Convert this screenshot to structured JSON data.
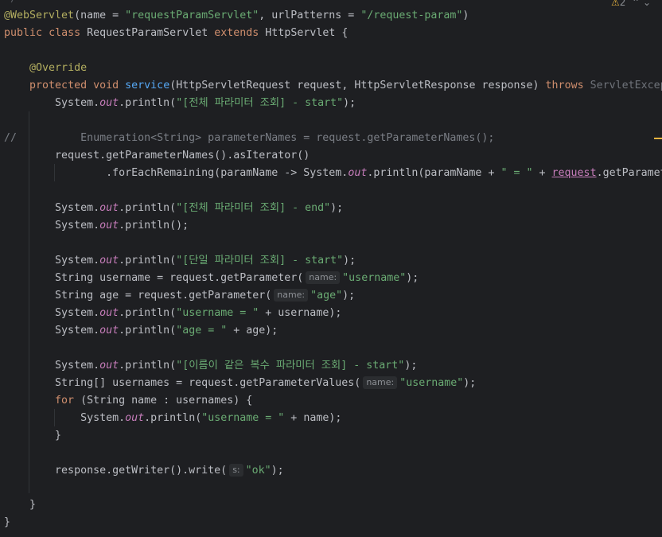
{
  "editor": {
    "inspection": {
      "warning_count": "2"
    },
    "top_fragment": "*/",
    "lines": {
      "l1": {
        "annotation": "@WebServlet",
        "p1": "(name = ",
        "s1": "\"requestParamServlet\"",
        "p2": ", urlPatterns = ",
        "s2": "\"/request-param\"",
        "p3": ")"
      },
      "l2": {
        "k1": "public",
        "k2": "class",
        "name": "RequestParamServlet",
        "k3": "extends",
        "parent": "HttpServlet {"
      },
      "l4": {
        "annotation": "@Override"
      },
      "l5": {
        "k1": "protected",
        "k2": "void",
        "method": "service",
        "params": "(HttpServletRequest request, HttpServletResponse response)",
        "k3": "throws",
        "exc": "ServletException"
      },
      "l6": {
        "a": "System.",
        "f": "out",
        "b": ".println(",
        "s": "\"[전체 파라미터 조회] - start\"",
        "c": ");"
      },
      "l8": {
        "comment": "//",
        "code": "Enumeration<String> parameterNames = request.getParameterNames();"
      },
      "l9": {
        "code": "request.getParameterNames().asIterator()"
      },
      "l10": {
        "a": ".forEachRemaining(paramName -> System.",
        "f": "out",
        "b": ".println(paramName + ",
        "s": "\" = \"",
        "c": " + ",
        "ref": "request",
        "d": ".getParameter(paramName)));"
      },
      "l12": {
        "a": "System.",
        "f": "out",
        "b": ".println(",
        "s": "\"[전체 파라미터 조회] - end\"",
        "c": ");"
      },
      "l13": {
        "a": "System.",
        "f": "out",
        "b": ".println();"
      },
      "l15": {
        "a": "System.",
        "f": "out",
        "b": ".println(",
        "s": "\"[단일 파라미터 조회] - start\"",
        "c": ");"
      },
      "l16": {
        "a": "String username = request.getParameter(",
        "hint": "name:",
        "s": "\"username\"",
        "c": ");"
      },
      "l17": {
        "a": "String age = request.getParameter(",
        "hint": "name:",
        "s": "\"age\"",
        "c": ");"
      },
      "l18": {
        "a": "System.",
        "f": "out",
        "b": ".println(",
        "s": "\"username = \"",
        "c": " + username);"
      },
      "l19": {
        "a": "System.",
        "f": "out",
        "b": ".println(",
        "s": "\"age = \"",
        "c": " + age);"
      },
      "l21": {
        "a": "System.",
        "f": "out",
        "b": ".println(",
        "s": "\"[이름이 같은 복수 파라미터 조회] - start\"",
        "c": ");"
      },
      "l22": {
        "a": "String[] usernames = request.getParameterValues(",
        "hint": "name:",
        "s": "\"username\"",
        "c": ");"
      },
      "l23": {
        "k": "for",
        "a": " (String name : usernames) {"
      },
      "l24": {
        "a": "System.",
        "f": "out",
        "b": ".println(",
        "s": "\"username = \"",
        "c": " + name);"
      },
      "l25": {
        "a": "}"
      },
      "l27": {
        "a": "response.getWriter().write(",
        "hint": "s:",
        "s": "\"ok\"",
        "c": ");"
      },
      "l29": {
        "a": "}"
      },
      "l30": {
        "a": "}"
      }
    }
  },
  "colors": {
    "background": "#1e1f22",
    "keyword": "#cf8e6d",
    "annotation": "#b3ae60",
    "string": "#6aab73",
    "field": "#c77dbb",
    "method": "#56a8f5",
    "comment": "#7a7e85",
    "warning": "#e8b43f"
  }
}
